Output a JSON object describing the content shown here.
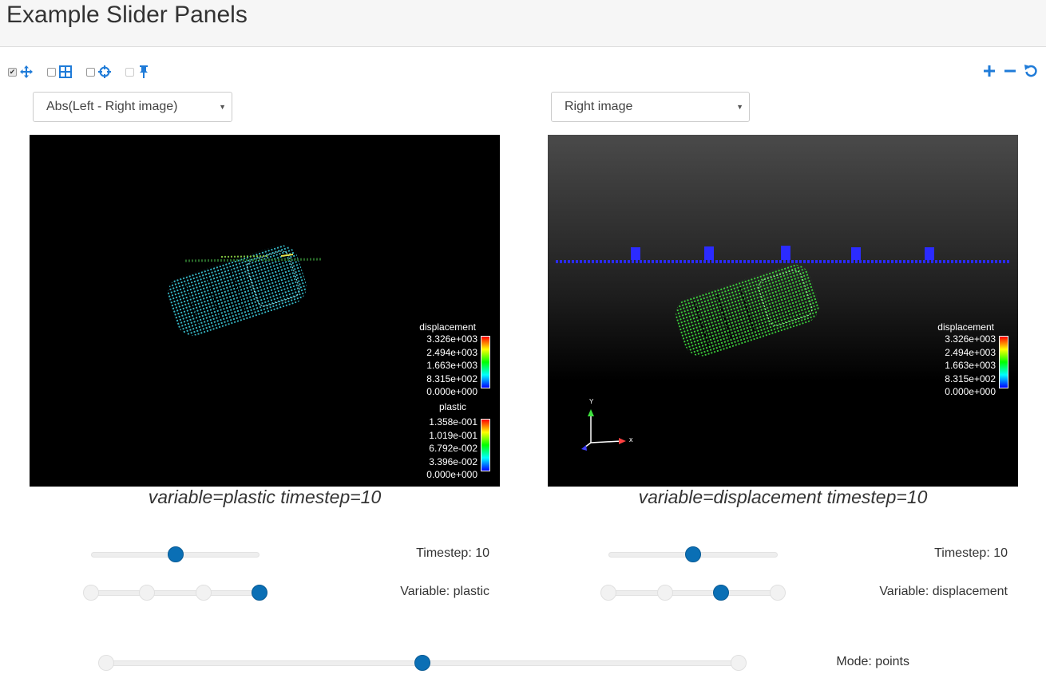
{
  "header": {
    "title": "Example Slider Panels"
  },
  "toolbar": {
    "checks": [
      true,
      false,
      false,
      false
    ],
    "icons": [
      "move-icon",
      "grid-icon",
      "crosshair-icon",
      "pin-icon"
    ],
    "right_icons": [
      "zoom-in-icon",
      "zoom-out-icon",
      "reset-icon"
    ],
    "accent": "#1f7bd8"
  },
  "left_panel": {
    "select_value": "Abs(Left - Right image)",
    "legend_displacement": {
      "title": "displacement",
      "labels": [
        "3.326e+003",
        "2.494e+003",
        "1.663e+003",
        "8.315e+002",
        "0.000e+000"
      ]
    },
    "legend_plastic": {
      "title": "plastic",
      "labels": [
        "1.358e-001",
        "1.019e-001",
        "6.792e-002",
        "3.396e-002",
        "0.000e+000"
      ]
    },
    "caption": "variable=plastic timestep=10",
    "timestep_label": "Timestep: 10",
    "timestep_position": 0.5,
    "variable_label": "Variable: plastic",
    "variable_ticks": 4,
    "variable_index": 3
  },
  "right_panel": {
    "select_value": "Right image",
    "legend_displacement": {
      "title": "displacement",
      "labels": [
        "3.326e+003",
        "2.494e+003",
        "1.663e+003",
        "8.315e+002",
        "0.000e+000"
      ]
    },
    "axes": {
      "x": "x",
      "y": "Y"
    },
    "caption": "variable=displacement timestep=10",
    "timestep_label": "Timestep: 10",
    "timestep_position": 0.5,
    "variable_label": "Variable: displacement",
    "variable_ticks": 4,
    "variable_index": 2
  },
  "mode": {
    "label": "Mode: points",
    "ticks": 3,
    "index": 1
  }
}
